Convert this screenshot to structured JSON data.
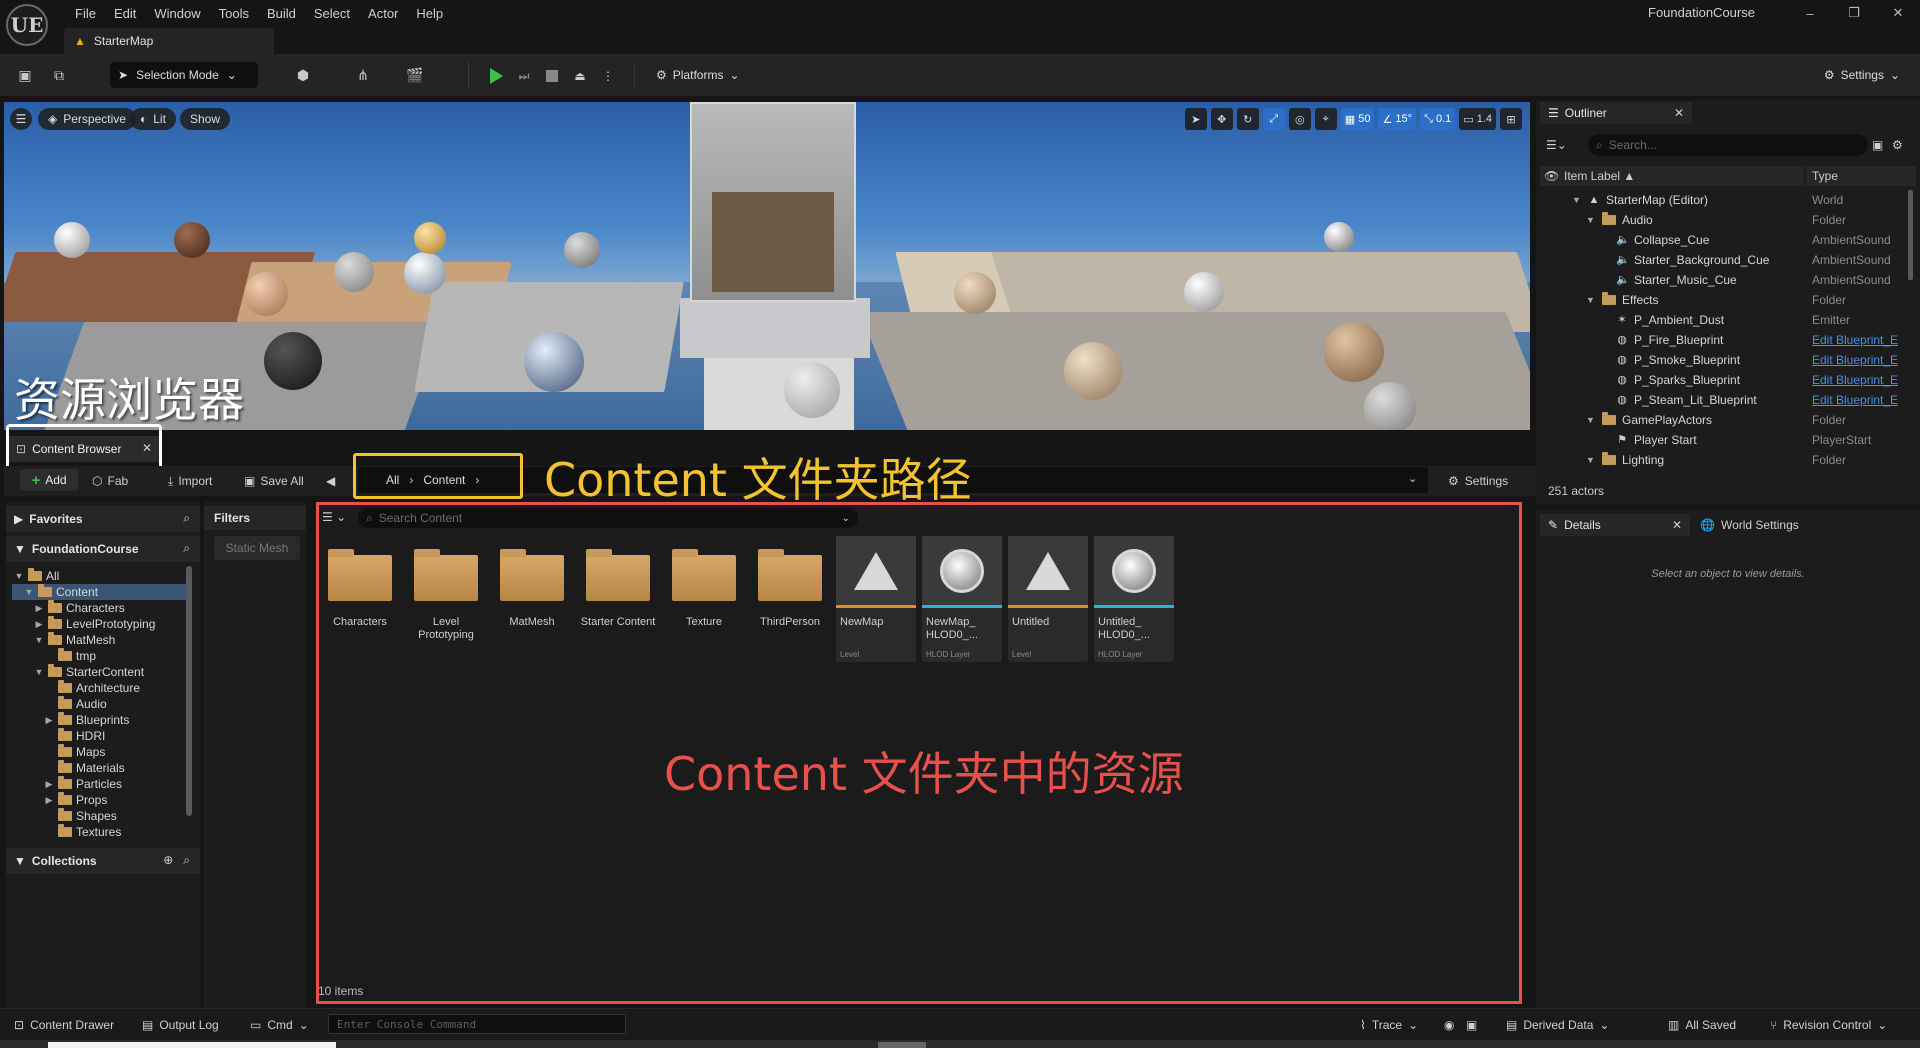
{
  "app": {
    "logo": "UE",
    "menus": [
      "File",
      "Edit",
      "Window",
      "Tools",
      "Build",
      "Select",
      "Actor",
      "Help"
    ],
    "project_name": "FoundationCourse",
    "window_controls": [
      "–",
      "❐",
      "✕"
    ]
  },
  "map_tab": {
    "label": "StarterMap"
  },
  "toolbar": {
    "selection_mode": "Selection Mode",
    "platforms": "Platforms",
    "settings": "Settings"
  },
  "viewport": {
    "menu_icon": "hamburger-icon",
    "perspective": "Perspective",
    "lit": "Lit",
    "show": "Show",
    "grid_snap": "50",
    "angle_snap": "15°",
    "scale_snap": "0.1",
    "camera_speed": "1.4",
    "overlay_title": "资源浏览器"
  },
  "content_browser": {
    "tab_label": "Content Browser",
    "add": "Add",
    "fab": "Fab",
    "import": "Import",
    "save_all": "Save All",
    "path": [
      "All",
      "Content"
    ],
    "path_annotation": "Content 文件夹路径",
    "settings": "Settings",
    "favorites": "Favorites",
    "project": "FoundationCourse",
    "collections": "Collections",
    "filters": "Filters",
    "filter_chip": "Static Mesh",
    "search_placeholder": "Search Content",
    "assets_annotation": "Content 文件夹中的资源",
    "items_count": "10 items",
    "tree": [
      {
        "label": "All",
        "depth": 0,
        "arrow": "▼"
      },
      {
        "label": "Content",
        "depth": 1,
        "arrow": "▼"
      },
      {
        "label": "Characters",
        "depth": 2,
        "arrow": "▶"
      },
      {
        "label": "LevelPrototyping",
        "depth": 2,
        "arrow": "▶"
      },
      {
        "label": "MatMesh",
        "depth": 2,
        "arrow": "▼"
      },
      {
        "label": "tmp",
        "depth": 3,
        "arrow": ""
      },
      {
        "label": "StarterContent",
        "depth": 2,
        "arrow": "▼"
      },
      {
        "label": "Architecture",
        "depth": 3,
        "arrow": ""
      },
      {
        "label": "Audio",
        "depth": 3,
        "arrow": ""
      },
      {
        "label": "Blueprints",
        "depth": 3,
        "arrow": "▶"
      },
      {
        "label": "HDRI",
        "depth": 3,
        "arrow": ""
      },
      {
        "label": "Maps",
        "depth": 3,
        "arrow": ""
      },
      {
        "label": "Materials",
        "depth": 3,
        "arrow": ""
      },
      {
        "label": "Particles",
        "depth": 3,
        "arrow": "▶"
      },
      {
        "label": "Props",
        "depth": 3,
        "arrow": "▶"
      },
      {
        "label": "Shapes",
        "depth": 3,
        "arrow": ""
      },
      {
        "label": "Textures",
        "depth": 3,
        "arrow": ""
      }
    ],
    "assets": [
      {
        "name": "Characters",
        "kind": "folder",
        "type": ""
      },
      {
        "name": "Level Prototyping",
        "kind": "folder",
        "type": ""
      },
      {
        "name": "MatMesh",
        "kind": "folder",
        "type": ""
      },
      {
        "name": "Starter Content",
        "kind": "folder",
        "type": ""
      },
      {
        "name": "Texture",
        "kind": "folder",
        "type": ""
      },
      {
        "name": "ThirdPerson",
        "kind": "folder",
        "type": ""
      },
      {
        "name": "NewMap",
        "kind": "level",
        "type": "Level"
      },
      {
        "name": "NewMap_ HLOD0_...",
        "kind": "hlod",
        "type": "HLOD Layer"
      },
      {
        "name": "Untitled",
        "kind": "level",
        "type": "Level"
      },
      {
        "name": "Untitled_ HLOD0_...",
        "kind": "hlod",
        "type": "HLOD Layer"
      }
    ]
  },
  "outliner": {
    "tab_label": "Outliner",
    "search_placeholder": "Search...",
    "col_label": "Item Label ▲",
    "col_type": "Type",
    "actors_count": "251 actors",
    "rows": [
      {
        "name": "StarterMap (Editor)",
        "type": "World",
        "depth": 0,
        "icon": "map-icon",
        "arrow": "▼",
        "link": false
      },
      {
        "name": "Audio",
        "type": "Folder",
        "depth": 1,
        "icon": "folder",
        "arrow": "▼",
        "link": false
      },
      {
        "name": "Collapse_Cue",
        "type": "AmbientSound",
        "depth": 2,
        "icon": "speaker-icon",
        "arrow": "",
        "link": false
      },
      {
        "name": "Starter_Background_Cue",
        "type": "AmbientSound",
        "depth": 2,
        "icon": "speaker-icon",
        "arrow": "",
        "link": false
      },
      {
        "name": "Starter_Music_Cue",
        "type": "AmbientSound",
        "depth": 2,
        "icon": "speaker-icon",
        "arrow": "",
        "link": false
      },
      {
        "name": "Effects",
        "type": "Folder",
        "depth": 1,
        "icon": "folder",
        "arrow": "▼",
        "link": false
      },
      {
        "name": "P_Ambient_Dust",
        "type": "Emitter",
        "depth": 2,
        "icon": "emitter-icon",
        "arrow": "",
        "link": false
      },
      {
        "name": "P_Fire_Blueprint",
        "type": "Edit Blueprint_E",
        "depth": 2,
        "icon": "blueprint-icon",
        "arrow": "",
        "link": true
      },
      {
        "name": "P_Smoke_Blueprint",
        "type": "Edit Blueprint_E",
        "depth": 2,
        "icon": "blueprint-icon",
        "arrow": "",
        "link": true
      },
      {
        "name": "P_Sparks_Blueprint",
        "type": "Edit Blueprint_E",
        "depth": 2,
        "icon": "blueprint-icon",
        "arrow": "",
        "link": true
      },
      {
        "name": "P_Steam_Lit_Blueprint",
        "type": "Edit Blueprint_E",
        "depth": 2,
        "icon": "blueprint-icon",
        "arrow": "",
        "link": true
      },
      {
        "name": "GamePlayActors",
        "type": "Folder",
        "depth": 1,
        "icon": "folder",
        "arrow": "▼",
        "link": false
      },
      {
        "name": "Player Start",
        "type": "PlayerStart",
        "depth": 2,
        "icon": "player-start-icon",
        "arrow": "",
        "link": false
      },
      {
        "name": "Lighting",
        "type": "Folder",
        "depth": 1,
        "icon": "folder",
        "arrow": "▼",
        "link": false
      }
    ]
  },
  "details": {
    "tab_label": "Details",
    "world_settings": "World Settings",
    "empty_text": "Select an object to view details."
  },
  "statusbar": {
    "content_drawer": "Content Drawer",
    "output_log": "Output Log",
    "cmd": "Cmd",
    "console_placeholder": "Enter Console Command",
    "trace": "Trace",
    "derived_data": "Derived Data",
    "all_saved": "All Saved",
    "revision_control": "Revision Control"
  },
  "colors": {
    "annotation_yellow": "#f3c231",
    "annotation_red": "#e8504b",
    "annotation_white": "#ffffff",
    "play_green": "#3ec14c",
    "accent_blue": "#2b6fc9"
  }
}
